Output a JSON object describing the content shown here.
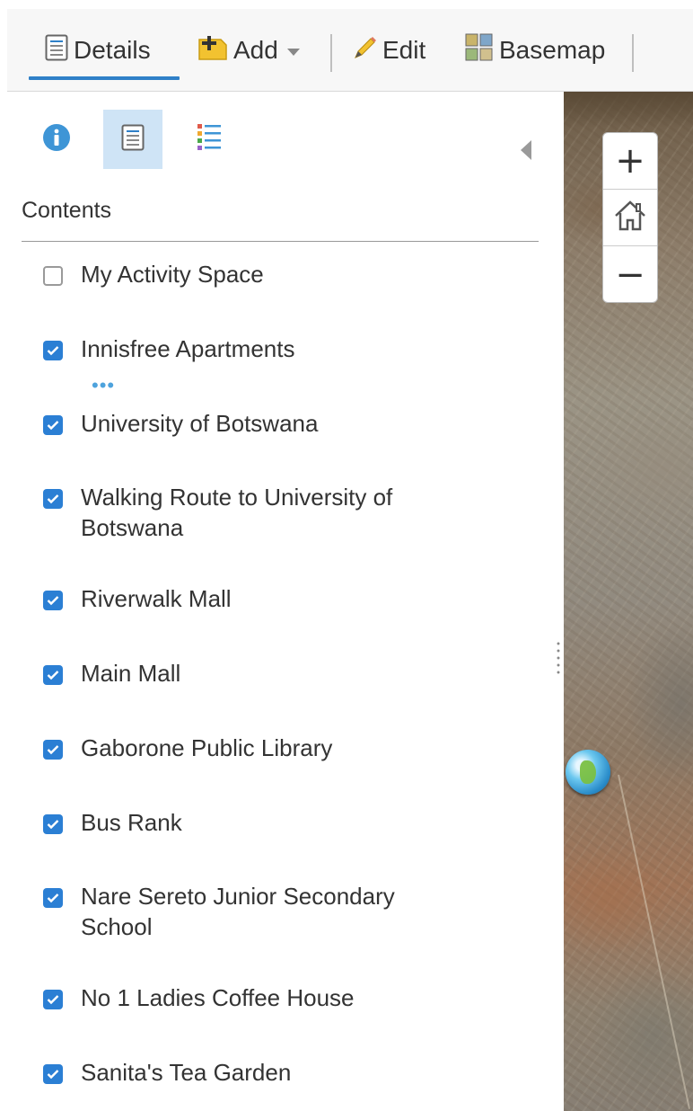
{
  "toolbar": {
    "details_label": "Details",
    "add_label": "Add",
    "edit_label": "Edit",
    "basemap_label": "Basemap"
  },
  "panel": {
    "contents_title": "Contents",
    "more_options": "•••",
    "layers": [
      {
        "name": "My Activity Space",
        "checked": false
      },
      {
        "name": "Innisfree Apartments",
        "checked": true
      },
      {
        "name": "University of Botswana",
        "checked": true
      },
      {
        "name": "Walking Route to University of Botswana",
        "checked": true
      },
      {
        "name": "Riverwalk Mall",
        "checked": true
      },
      {
        "name": "Main Mall",
        "checked": true
      },
      {
        "name": "Gaborone Public Library",
        "checked": true
      },
      {
        "name": "Bus Rank",
        "checked": true
      },
      {
        "name": "Nare Sereto Junior Secondary School",
        "checked": true
      },
      {
        "name": "No 1 Ladies Coffee House",
        "checked": true
      },
      {
        "name": "Sanita's Tea Garden",
        "checked": true
      }
    ]
  },
  "map": {
    "zoom_in_symbol": "+",
    "zoom_out_symbol": "−"
  },
  "colors": {
    "accent": "#2b7fd4",
    "toolbar_underline": "#2f80c8",
    "active_tab_bg": "#cfe4f6"
  },
  "icons": {
    "details": "details-list-icon",
    "add": "add-icon",
    "edit": "pencil-icon",
    "basemap": "basemap-grid-icon",
    "info": "info-icon",
    "legend": "legend-icon",
    "home": "home-icon"
  }
}
